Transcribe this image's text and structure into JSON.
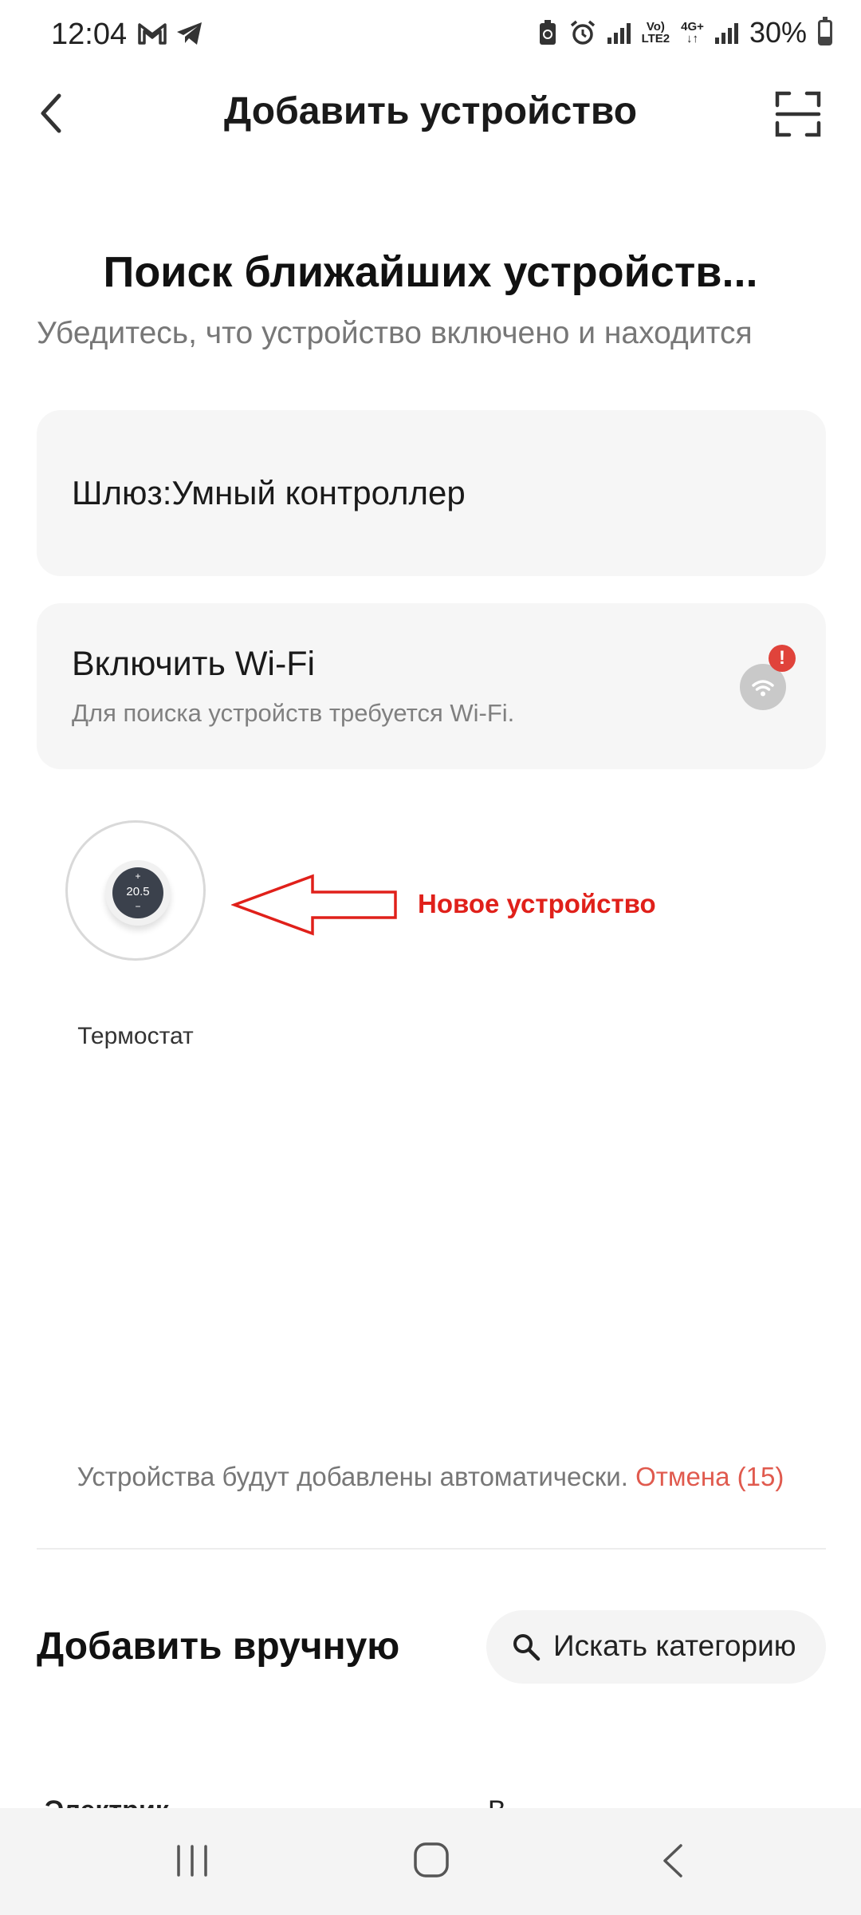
{
  "status_bar": {
    "time": "12:04",
    "network_top": "Vo)",
    "network_bottom": "LTE2",
    "net2_top": "4G+",
    "net2_bottom": "↓↑",
    "battery_percent": "30%",
    "battery_level": 0.3,
    "left_icons": [
      "gmail-icon",
      "telegram-icon"
    ],
    "right_icons": [
      "battery-saver-icon",
      "alarm-icon",
      "signal-icon",
      "signal-icon"
    ]
  },
  "header": {
    "title": "Добавить устройство"
  },
  "search": {
    "title": "Поиск ближайших устройств...",
    "subtitle": "Убедитесь, что устройство включено и находится"
  },
  "gateway_card": {
    "label": "Шлюз:Умный контроллер"
  },
  "wifi_card": {
    "title": "Включить Wi-Fi",
    "subtitle": "Для поиска устройств требуется Wi-Fi.",
    "alert": "!"
  },
  "device": {
    "name": "Термостат",
    "display_value": "20.5",
    "plus": "+",
    "minus": "−"
  },
  "annotation": {
    "text": "Новое устройство",
    "color": "#e0201a"
  },
  "auto_add": {
    "text": "Устройства будут добавлены автоматически. ",
    "cancel": "Отмена (15)"
  },
  "manual": {
    "title": "Добавить вручную",
    "search_category": "Искать категорию",
    "partial_left": "Электрик",
    "partial_right": "В"
  },
  "colors": {
    "accent_red": "#e05a4e",
    "card_bg": "#f6f6f6"
  }
}
